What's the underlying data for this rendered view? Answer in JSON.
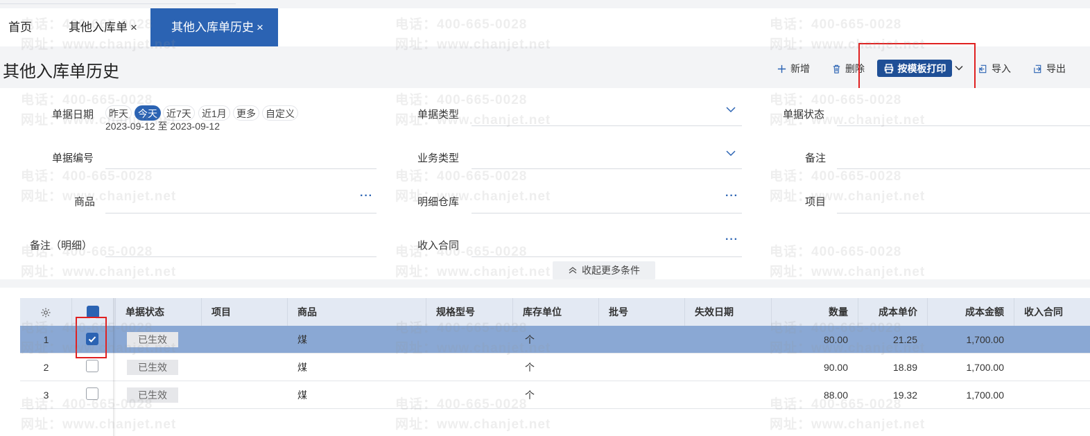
{
  "tabs": {
    "home": "首页",
    "other_inbound": "其他入库单",
    "history": "其他入库单历史",
    "close": "×"
  },
  "page_title": "其他入库单历史",
  "toolbar": {
    "add": "新增",
    "delete": "删除",
    "print_template": "按模板打印",
    "import": "导入",
    "export": "导出"
  },
  "filters": {
    "doc_date_label": "单据日期",
    "date_chips": [
      "昨天",
      "今天",
      "近7天",
      "近1月",
      "更多",
      "自定义"
    ],
    "selected_chip": "今天",
    "date_range": "2023-09-12 至 2023-09-12",
    "doc_type_label": "单据类型",
    "doc_status_label": "单据状态",
    "doc_number_label": "单据编号",
    "biz_type_label": "业务类型",
    "remark_label": "备注",
    "product_label": "商品",
    "detail_warehouse_label": "明细仓库",
    "project_label": "项目",
    "detail_remark_label": "备注（明细）",
    "income_contract_label": "收入合同",
    "collapse_label": "收起更多条件",
    "more_dots": "···"
  },
  "table": {
    "columns": [
      "单据状态",
      "项目",
      "商品",
      "规格型号",
      "库存单位",
      "批号",
      "失效日期",
      "数量",
      "成本单价",
      "成本金额",
      "收入合同"
    ],
    "rows": [
      {
        "index": "1",
        "checked": true,
        "status": "已生效",
        "project": "",
        "product": "煤",
        "spec": "",
        "unit": "个",
        "batch": "",
        "expiry": "",
        "qty": "80.00",
        "unit_cost": "21.25",
        "cost_amount": "1,700.00",
        "contract": ""
      },
      {
        "index": "2",
        "checked": false,
        "status": "已生效",
        "project": "",
        "product": "煤",
        "spec": "",
        "unit": "个",
        "batch": "",
        "expiry": "",
        "qty": "90.00",
        "unit_cost": "18.89",
        "cost_amount": "1,700.00",
        "contract": ""
      },
      {
        "index": "3",
        "checked": false,
        "status": "已生效",
        "project": "",
        "product": "煤",
        "spec": "",
        "unit": "个",
        "batch": "",
        "expiry": "",
        "qty": "88.00",
        "unit_cost": "19.32",
        "cost_amount": "1,700.00",
        "contract": ""
      }
    ]
  },
  "watermark": {
    "phone": "电话：400-665-0028",
    "site": "网址：www.chanjet.net"
  },
  "colors": {
    "primary": "#2b63b3",
    "print_button": "#1f4f96",
    "selected_row": "#8aa8d4",
    "highlight_box": "#e02020"
  }
}
